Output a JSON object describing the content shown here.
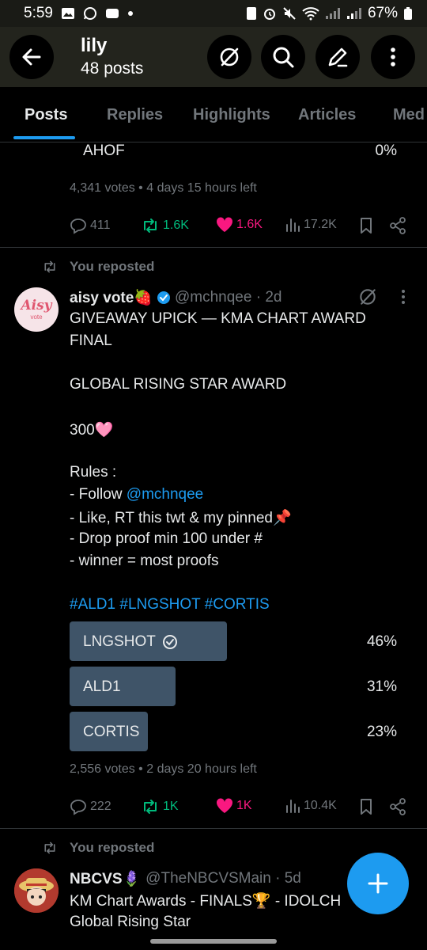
{
  "status_bar": {
    "time": "5:59",
    "battery": "67%"
  },
  "header": {
    "name": "lily",
    "post_count": "48 posts"
  },
  "tabs": [
    "Posts",
    "Replies",
    "Highlights",
    "Articles",
    "Med"
  ],
  "prev_post": {
    "poll_last_option": "AHOF",
    "poll_last_pct": "0%",
    "meta": "4,341 votes • 4 days 15 hours left",
    "replies": "411",
    "reposts": "1.6K",
    "likes": "1.6K",
    "views": "17.2K"
  },
  "post1": {
    "repost_label": "You reposted",
    "avatar_text": "Aisy",
    "avatar_sub": "vote",
    "display_name": "aisy vote🍓",
    "handle": "@mchnqee · 2d",
    "lines": {
      "l1": "GIVEAWAY UPICK — KMA CHART AWARD",
      "l2": "FINAL",
      "l3": "GLOBAL RISING STAR AWARD",
      "l4": "300🩷",
      "l5": "Rules :",
      "l6_prefix": "- Follow ",
      "l6_link": "@mchnqee",
      "l7": "- Like, RT this twt & my pinned📌",
      "l8": "- Drop proof min 100 under #",
      "l9": "- winner = most proofs",
      "hashtags": "#ALD1 #LNGSHOT #CORTIS"
    },
    "poll": [
      {
        "label": "LNGSHOT",
        "pct": "46%",
        "value": 46,
        "selected": true
      },
      {
        "label": "ALD1",
        "pct": "31%",
        "value": 31,
        "selected": false
      },
      {
        "label": "CORTIS",
        "pct": "23%",
        "value": 23,
        "selected": false
      }
    ],
    "meta": "2,556 votes • 2 days 20 hours left",
    "replies": "222",
    "reposts": "1K",
    "likes": "1K",
    "views": "10.4K"
  },
  "post2": {
    "repost_label": "You reposted",
    "display_name": "NBCVS🪻",
    "handle": "@TheNBCVSMain · 5d",
    "line1": "KM Chart Awards - FINALS🏆 - IDOLCH",
    "line2": "Global Rising Star"
  },
  "colors": {
    "accent": "#1d9bf0",
    "repost_green": "#00ba7c",
    "like_pink": "#f91880",
    "poll_bar": "#3f5468"
  }
}
